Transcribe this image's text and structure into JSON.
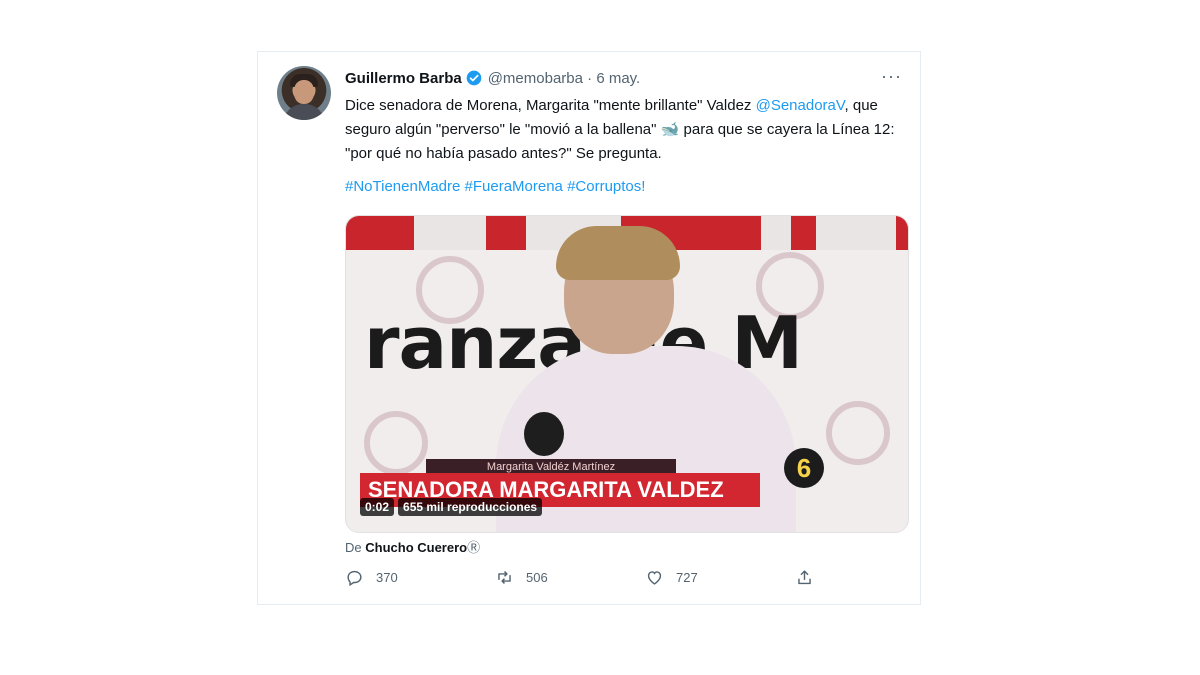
{
  "tweet": {
    "author_name": "Guillermo Barba",
    "handle": "@memobarba",
    "separator": "·",
    "date": "6 may.",
    "more": "···",
    "text_part1": "Dice senadora de Morena, Margarita \"mente brillante\" Valdez ",
    "mention": "@SenadoraV",
    "text_part2": ", que seguro algún \"perverso\" le \"movió a la ballena\" ",
    "emoji": "🐋",
    "text_part3": " para que se cayera la Línea 12: \"por qué no había pasado antes?\" Se pregunta.",
    "hashtags": "#NoTienenMadre #FueraMorena #Corruptos!"
  },
  "video": {
    "background_text": "ranza de M",
    "lower_third_small": "Margarita Valdéz Martínez",
    "lower_third": "SENADORA MARGARITA VALDEZ",
    "channel_logo": "6",
    "time": "0:02",
    "views": "655 mil reproducciones"
  },
  "attribution": {
    "prefix": "De",
    "source": "Chucho Cuerero",
    "badge": "Ⓡ"
  },
  "actions": {
    "replies": "370",
    "retweets": "506",
    "likes": "727"
  },
  "colors": {
    "link": "#1d9bf0",
    "secondary": "#536471",
    "lower_third": "#d22630"
  },
  "icons": [
    "verified-icon",
    "more-icon",
    "reply-icon",
    "retweet-icon",
    "like-icon",
    "share-icon"
  ]
}
